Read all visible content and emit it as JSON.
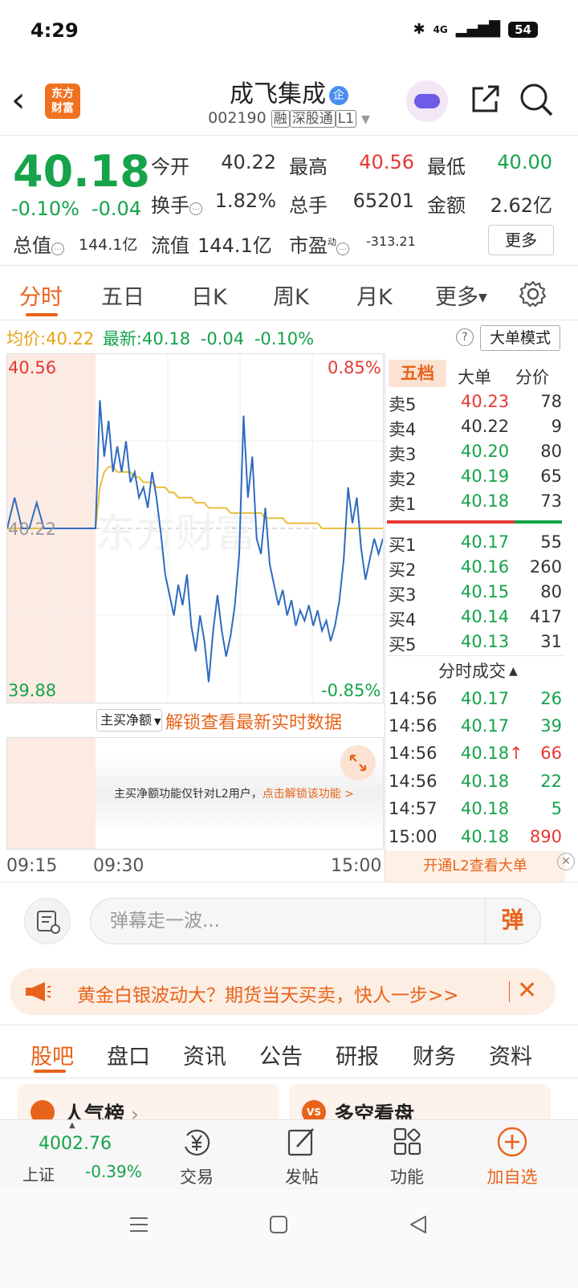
{
  "status": {
    "time": "4:29",
    "network": "4G",
    "battery": "54"
  },
  "header": {
    "logo_line1": "东方",
    "logo_line2": "财富",
    "name": "成飞集成",
    "name_badge": "企",
    "code": "002190",
    "tag1": "融",
    "tag2": "深股通",
    "tag3": "L1"
  },
  "quote": {
    "price": "40.18",
    "pct": "-0.10%",
    "change": "-0.04",
    "open_label": "今开",
    "open": "40.22",
    "high_label": "最高",
    "high": "40.56",
    "low_label": "最低",
    "low": "40.00",
    "turnover_label": "换手",
    "turnover": "1.82%",
    "volume_label": "总手",
    "volume": "65201",
    "amount_label": "金额",
    "amount": "2.62亿",
    "mktcap_label": "总值",
    "mktcap": "144.1亿",
    "float_label": "流值",
    "float": "144.1亿",
    "pe_label": "市盈",
    "pe_sup": "动",
    "pe": "-313.21",
    "more": "更多"
  },
  "tabs": [
    "分时",
    "五日",
    "日K",
    "周K",
    "月K",
    "更多"
  ],
  "avg_row": {
    "avg_label": "均价:",
    "avg": "40.22",
    "latest_label": "最新:",
    "latest": "40.18",
    "chg": "-0.04",
    "pct": "-0.10%",
    "big_mode": "大单模式"
  },
  "chart": {
    "y_top": "40.56",
    "y_mid": "40.22",
    "y_bottom": "39.88",
    "pct_top": "0.85%",
    "pct_bottom": "-0.85%",
    "watermark": "东方财富",
    "x_start": "09:15",
    "x_open": "09:30",
    "x_end": "15:00"
  },
  "chart_data": {
    "type": "line",
    "ylim": [
      39.88,
      40.56
    ],
    "reference": 40.22,
    "series": [
      {
        "values": [
          40.22,
          40.28,
          40.22,
          40.22,
          40.27,
          40.22,
          40.22,
          40.22,
          40.22,
          40.22,
          40.22,
          40.22,
          40.22,
          40.47,
          40.36,
          40.43,
          40.33,
          40.38,
          40.33,
          40.39,
          40.31,
          40.33,
          40.28,
          40.3,
          40.26,
          40.33,
          40.28,
          40.21,
          40.13,
          40.09,
          40.05,
          40.11,
          40.07,
          40.13,
          40.03,
          39.98,
          40.05,
          40.0,
          39.92,
          40.02,
          40.09,
          40.02,
          39.97,
          40.01,
          40.07,
          40.17,
          40.44,
          40.28,
          40.36,
          40.2,
          40.17,
          40.26,
          40.15,
          40.11,
          40.07,
          40.1,
          40.05,
          40.08,
          40.03,
          40.06,
          40.04,
          40.07,
          40.03,
          40.06,
          40.02,
          40.04,
          40.0,
          40.03,
          40.08,
          40.16,
          40.3,
          40.23,
          40.28,
          40.18,
          40.12,
          40.16,
          40.2,
          40.17,
          40.2
        ]
      },
      {
        "values": [
          40.22,
          40.22,
          40.22,
          40.22,
          40.22,
          40.22,
          40.22,
          40.22,
          40.22,
          40.22,
          40.22,
          40.22,
          40.22,
          40.3,
          40.33,
          40.34,
          40.34,
          40.33,
          40.33,
          40.33,
          40.33,
          40.32,
          40.32,
          40.31,
          40.31,
          40.31,
          40.3,
          40.3,
          40.3,
          40.29,
          40.29,
          40.28,
          40.28,
          40.28,
          40.28,
          40.27,
          40.27,
          40.27,
          40.26,
          40.26,
          40.26,
          40.26,
          40.26,
          40.25,
          40.25,
          40.25,
          40.25,
          40.25,
          40.25,
          40.25,
          40.25,
          40.24,
          40.24,
          40.24,
          40.24,
          40.24,
          40.23,
          40.23,
          40.23,
          40.23,
          40.23,
          40.23,
          40.23,
          40.23,
          40.22,
          40.22,
          40.22,
          40.22,
          40.22,
          40.22,
          40.22,
          40.22,
          40.22,
          40.22,
          40.22,
          40.22,
          40.22,
          40.22,
          40.22
        ]
      }
    ]
  },
  "sub_chart": {
    "selector": "主买净额",
    "unlock": "解锁查看最新实时数据",
    "msg": "主买净额功能仅针对L2用户，",
    "msg_link": "点击解锁该功能 >"
  },
  "orderbook": {
    "tabs": [
      "五档",
      "大单",
      "分价"
    ],
    "asks": [
      {
        "label": "卖5",
        "price": "40.23",
        "vol": "78"
      },
      {
        "label": "卖4",
        "price": "40.22",
        "vol": "9"
      },
      {
        "label": "卖3",
        "price": "40.20",
        "vol": "80"
      },
      {
        "label": "卖2",
        "price": "40.19",
        "vol": "65"
      },
      {
        "label": "卖1",
        "price": "40.18",
        "vol": "73"
      }
    ],
    "bids": [
      {
        "label": "买1",
        "price": "40.17",
        "vol": "55"
      },
      {
        "label": "买2",
        "price": "40.16",
        "vol": "260"
      },
      {
        "label": "买3",
        "price": "40.15",
        "vol": "80"
      },
      {
        "label": "买4",
        "price": "40.14",
        "vol": "417"
      },
      {
        "label": "买5",
        "price": "40.13",
        "vol": "31"
      }
    ],
    "trades_title": "分时成交",
    "trades": [
      {
        "time": "14:56",
        "price": "40.17",
        "vol": "26"
      },
      {
        "time": "14:56",
        "price": "40.17",
        "vol": "39"
      },
      {
        "time": "14:56",
        "price": "40.18",
        "vol": "66",
        "arrow": "↑"
      },
      {
        "time": "14:56",
        "price": "40.18",
        "vol": "22"
      },
      {
        "time": "14:57",
        "price": "40.18",
        "vol": "5"
      },
      {
        "time": "15:00",
        "price": "40.18",
        "vol": "890"
      }
    ],
    "l2": "开通L2查看大单"
  },
  "danmu": {
    "placeholder": "弹幕走一波...",
    "button": "弹"
  },
  "promo": {
    "text": "黄金白银波动大？期货当天买卖，快人一步>>"
  },
  "section_tabs": [
    "股吧",
    "盘口",
    "资讯",
    "公告",
    "研报",
    "财务",
    "资料"
  ],
  "cards": {
    "left": "人气榜",
    "right": "多空看盘",
    "right_icon": "VS"
  },
  "bottom": {
    "index_value": "4002.76",
    "index_name": "上证",
    "index_chg": "-0.39%",
    "nav": [
      "交易",
      "发帖",
      "功能",
      "加自选"
    ]
  },
  "colors": {
    "up": "#e53935",
    "down": "#16a34a",
    "accent": "#e8631a",
    "price_line": "#2f6bbf",
    "avg_line": "#e8bf3c"
  }
}
